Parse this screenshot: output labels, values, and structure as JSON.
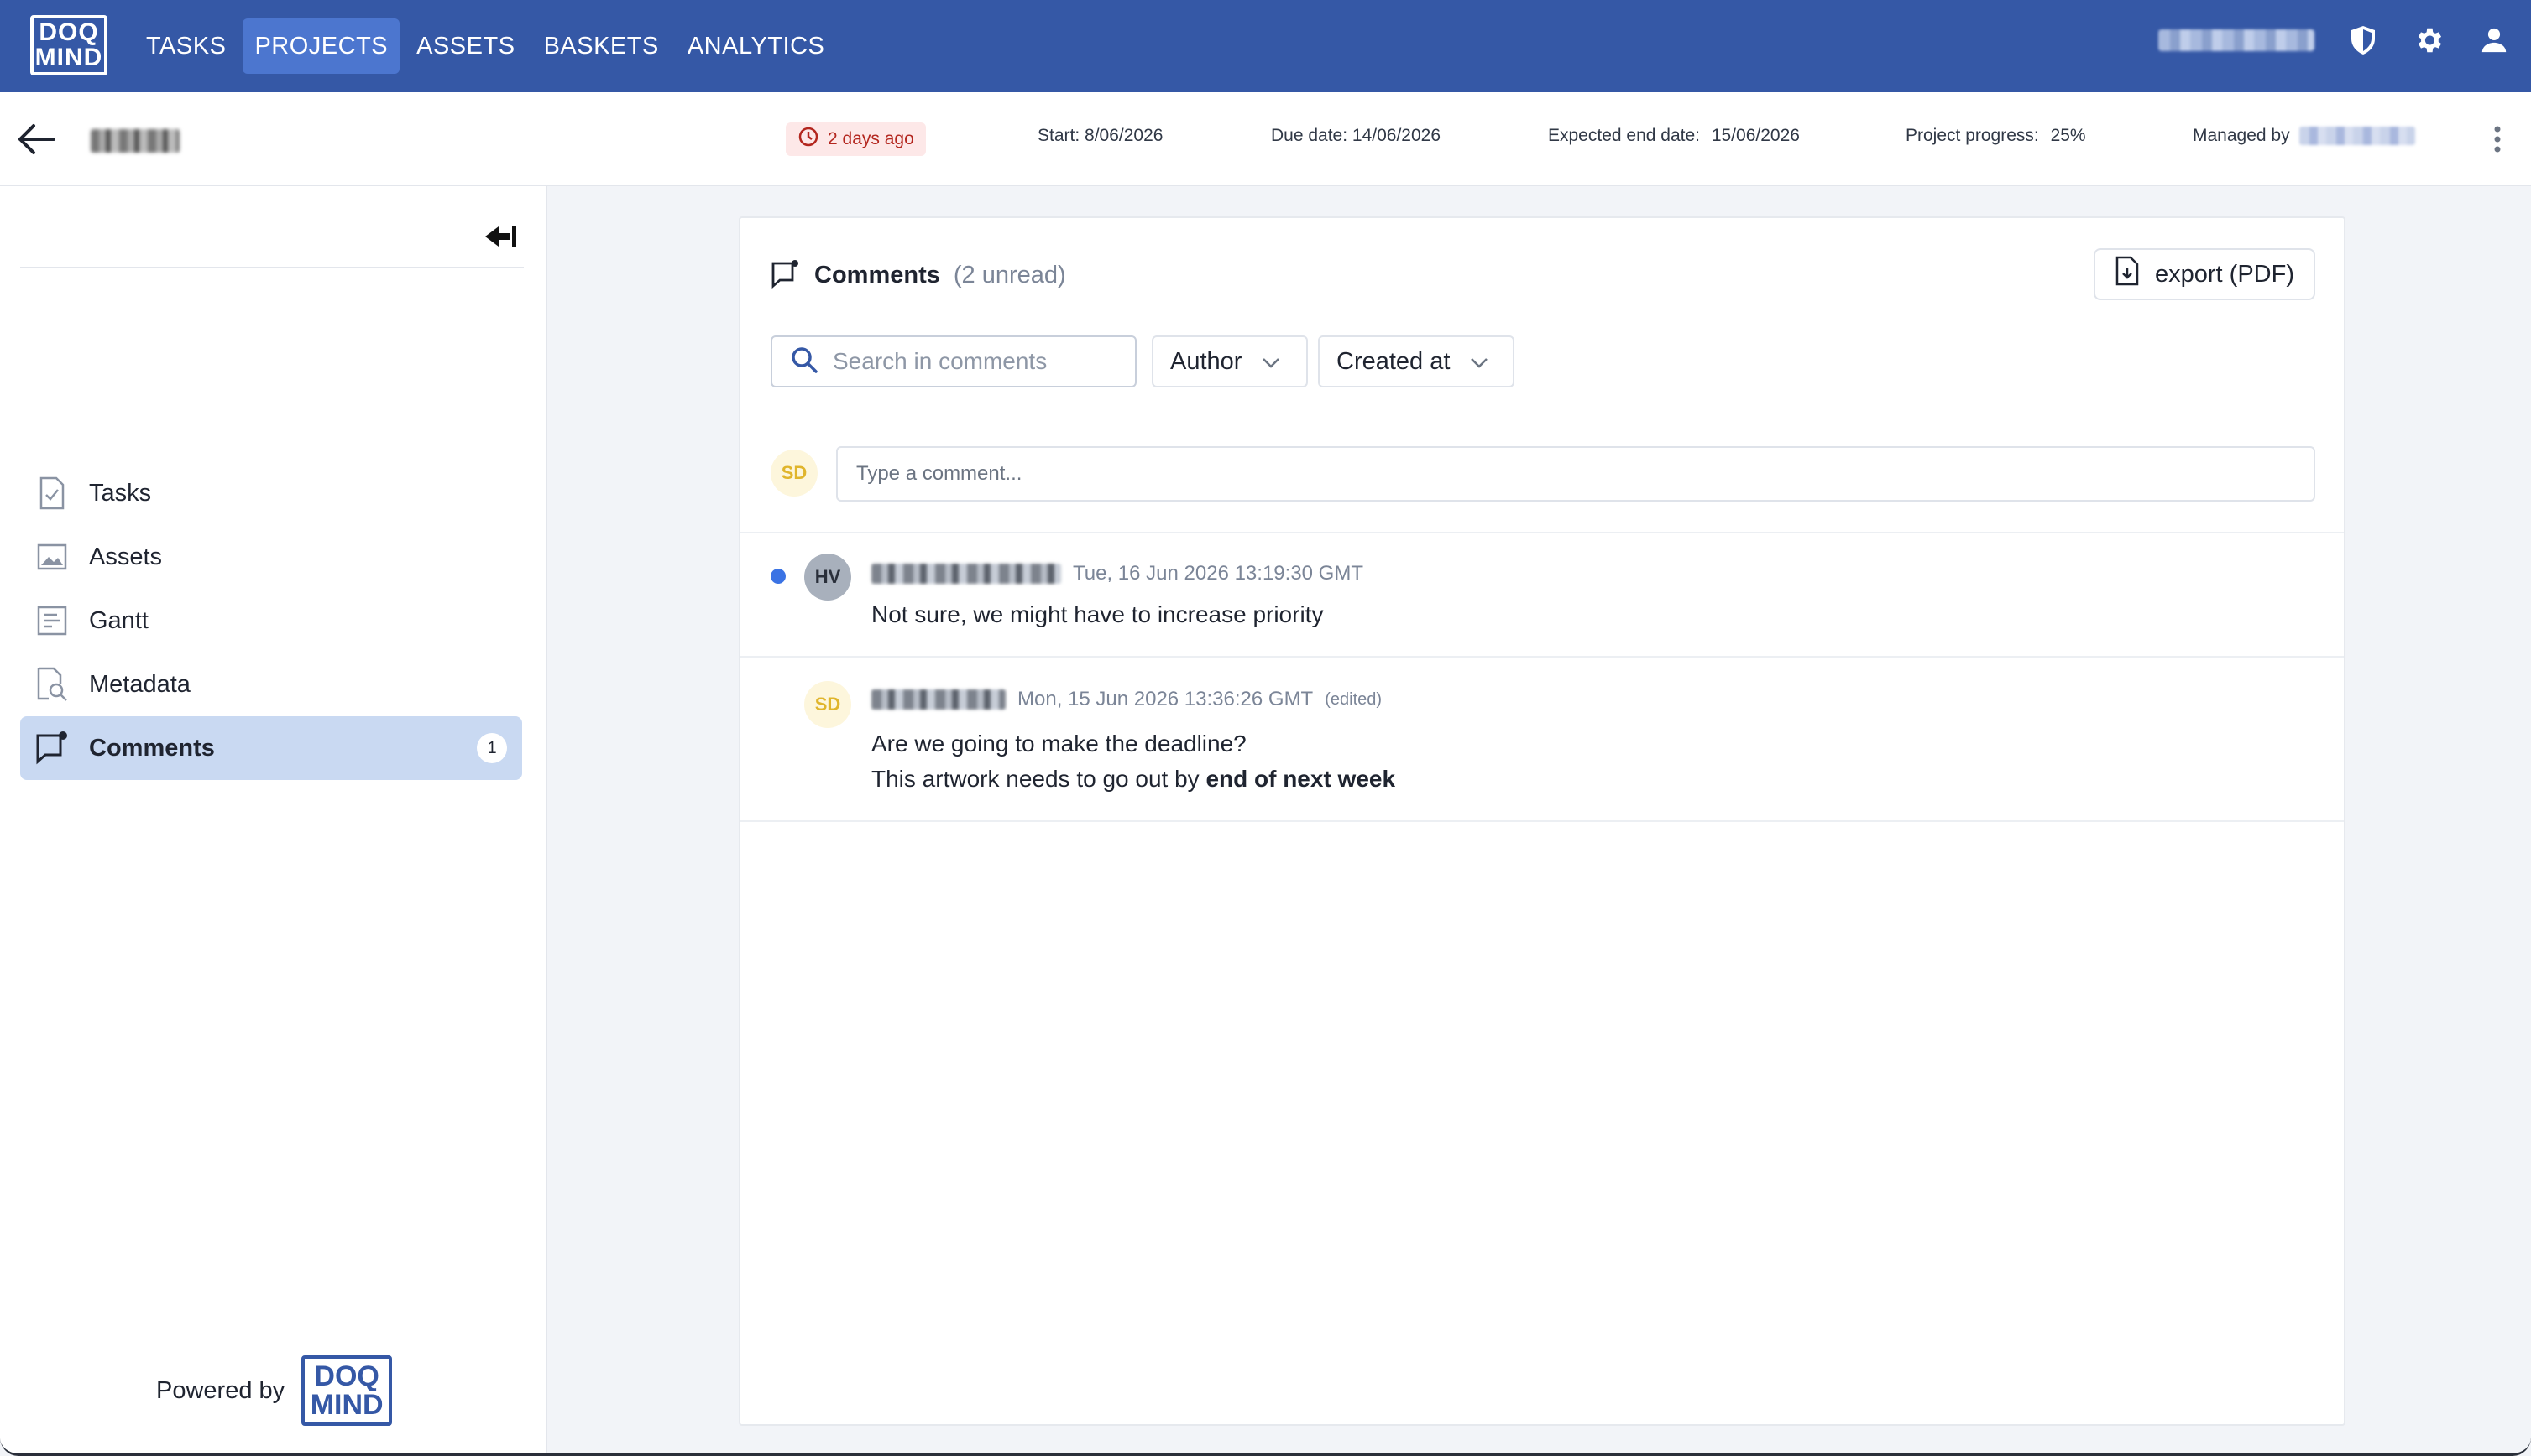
{
  "logo": {
    "line1": "DOQ",
    "line2": "MIND"
  },
  "nav": {
    "items": [
      {
        "label": "TASKS",
        "active": false
      },
      {
        "label": "PROJECTS",
        "active": true
      },
      {
        "label": "ASSETS",
        "active": false
      },
      {
        "label": "BASKETS",
        "active": false
      },
      {
        "label": "ANALYTICS",
        "active": false
      }
    ],
    "icons": [
      "shield-icon",
      "gear-icon",
      "user-icon"
    ]
  },
  "project": {
    "overdue": "2 days ago",
    "start_label": "Start:",
    "start": "8/06/2026",
    "due_label": "Due date:",
    "due": "14/06/2026",
    "expected_label": "Expected end date:",
    "expected": "15/06/2026",
    "progress_label": "Project progress:",
    "progress": "25%",
    "managed_label": "Managed by"
  },
  "sidebar": {
    "items": [
      {
        "label": "Tasks",
        "icon": "task-doc-icon"
      },
      {
        "label": "Assets",
        "icon": "image-icon"
      },
      {
        "label": "Gantt",
        "icon": "gantt-icon"
      },
      {
        "label": "Metadata",
        "icon": "metadata-search-icon"
      },
      {
        "label": "Comments",
        "icon": "comment-icon",
        "active": true,
        "badge": "1"
      }
    ],
    "powered_by": "Powered by"
  },
  "comments": {
    "title": "Comments",
    "unread": "(2 unread)",
    "export_label": "export (PDF)",
    "search_placeholder": "Search in comments",
    "filter_author": "Author",
    "filter_created": "Created at",
    "current_user_initials": "SD",
    "input_placeholder": "Type a comment...",
    "list": [
      {
        "initials": "HV",
        "timestamp": "Tue, 16 Jun 2026 13:19:30 GMT",
        "unread": true,
        "lines": [
          "Not sure, we might have to increase priority"
        ]
      },
      {
        "initials": "SD",
        "timestamp": "Mon, 15 Jun 2026 13:36:26 GMT",
        "edited": "(edited)",
        "line1": "Are we going to make the deadline?",
        "line2_prefix": "This artwork needs to go out by",
        "line2_bold": "end of next week"
      }
    ]
  },
  "colors": {
    "brand": "#3558a6",
    "nav_active": "#4c76cf",
    "sidebar_active": "#c9d9f2",
    "unread_dot": "#3b73e4",
    "overdue_bg": "#fde8e8",
    "overdue_text": "#b3261e"
  }
}
